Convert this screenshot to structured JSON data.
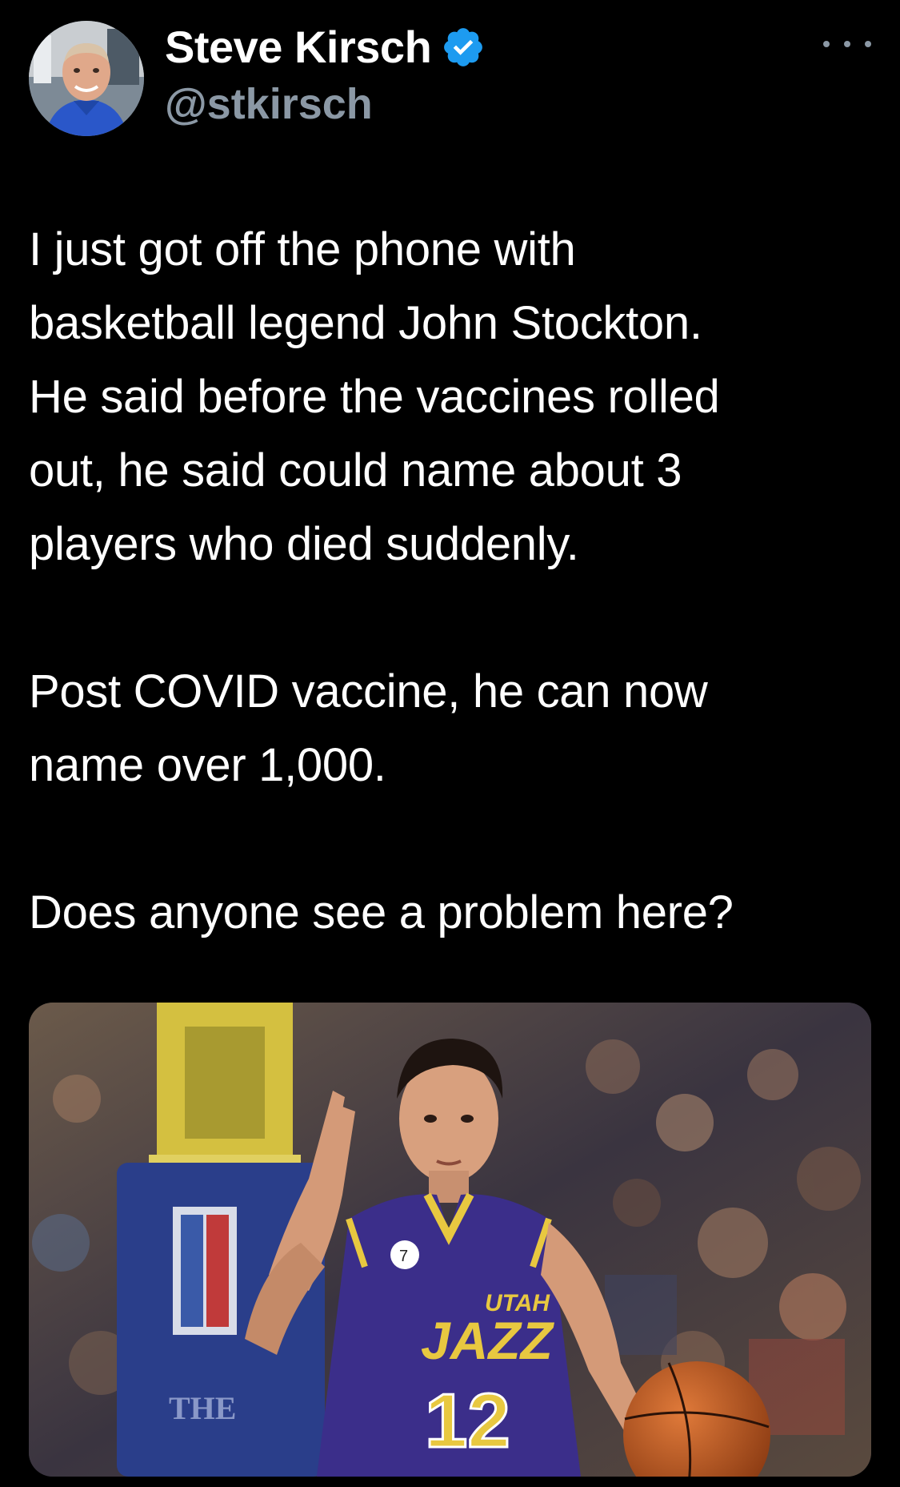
{
  "tweet": {
    "author": {
      "display_name": "Steve Kirsch",
      "handle": "@stkirsch",
      "verified": true,
      "verified_icon": "verified-badge-icon",
      "verified_color": "#1d9bf0"
    },
    "more_icon": "more-options-icon",
    "body": {
      "paragraphs": [
        {
          "lines": [
            "I just got off the phone with",
            "basketball legend John Stockton.",
            "He said before the vaccines rolled",
            "out, he said could name about 3",
            "players who died suddenly."
          ]
        },
        {
          "lines": [
            "Post COVID vaccine, he can now",
            "name over 1,000."
          ]
        },
        {
          "lines": [
            "Does anyone see a problem here?"
          ]
        }
      ]
    },
    "media": {
      "jersey_team": "UTAH",
      "jersey_logo": "JAZZ",
      "jersey_number": "12",
      "stanchion_text": "THE"
    }
  },
  "colors": {
    "background": "#000000",
    "text": "#ffffff",
    "secondary_text": "#8b98a5",
    "accent": "#1d9bf0"
  }
}
